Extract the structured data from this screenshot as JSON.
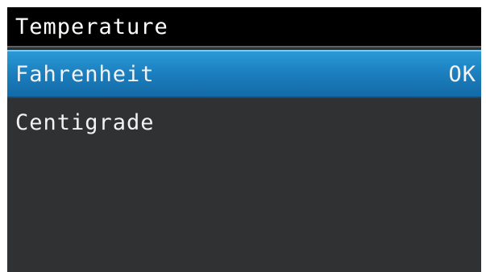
{
  "header": {
    "title": "Temperature"
  },
  "menu": {
    "items": [
      {
        "label": "Fahrenheit",
        "status": "OK",
        "selected": true
      },
      {
        "label": "Centigrade",
        "selected": false
      }
    ]
  },
  "colors": {
    "background": "#303133",
    "title_bar": "#000000",
    "selection": "#1d80c0",
    "text": "#f2f2f2"
  }
}
